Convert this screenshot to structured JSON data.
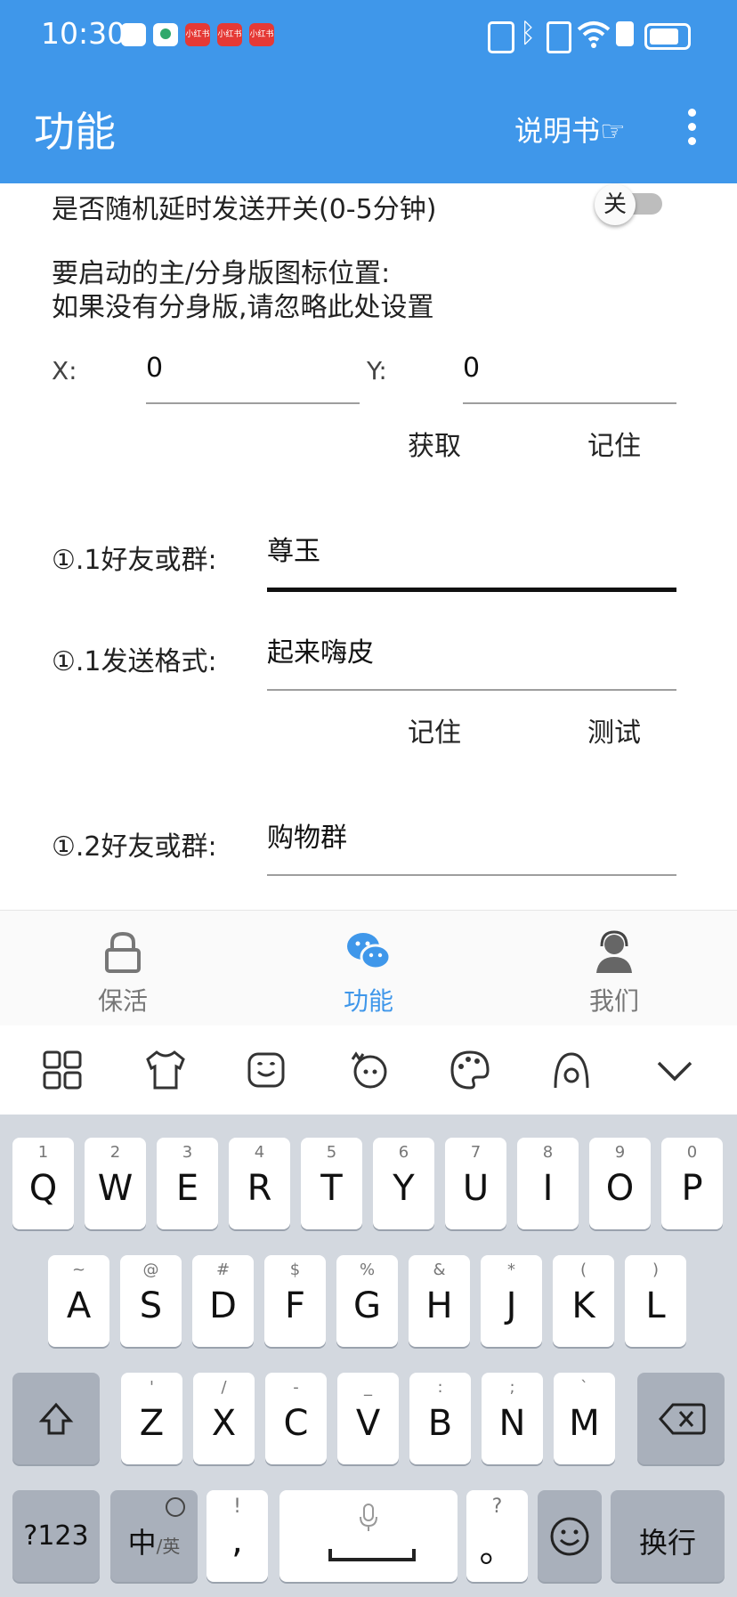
{
  "status_bar": {
    "time": "10:30",
    "app_icon_text": "小红书",
    "accent": "#3f97ea"
  },
  "app_bar": {
    "title": "功能",
    "manual_label": "说明书☞",
    "more_icon": "more-vert-icon"
  },
  "settings": {
    "random_delay_label": "是否随机延时发送开关(0-5分钟)",
    "random_delay_switch_text": "关",
    "icon_position_line1": "要启动的主/分身版图标位置:",
    "icon_position_line2": "如果没有分身版,请忽略此处设置",
    "x_label": "X:",
    "x_value": "0",
    "y_label": "Y:",
    "y_value": "0",
    "get_button": "获取",
    "remember_button": "记住"
  },
  "entries": {
    "friend1_label": "①.1好友或群:",
    "friend1_value": "尊玉",
    "format1_label": "①.1发送格式:",
    "format1_value": "起来嗨皮",
    "remember_button": "记住",
    "test_button": "测试",
    "friend2_label": "①.2好友或群:",
    "friend2_value": "购物群"
  },
  "bottom_nav": [
    {
      "label": "保活",
      "icon": "lock-icon"
    },
    {
      "label": "功能",
      "icon": "wechat-icon",
      "active": true
    },
    {
      "label": "我们",
      "icon": "support-agent-icon"
    }
  ],
  "keyboard": {
    "row1": [
      {
        "hint": "1",
        "key": "Q"
      },
      {
        "hint": "2",
        "key": "W"
      },
      {
        "hint": "3",
        "key": "E"
      },
      {
        "hint": "4",
        "key": "R"
      },
      {
        "hint": "5",
        "key": "T"
      },
      {
        "hint": "6",
        "key": "Y"
      },
      {
        "hint": "7",
        "key": "U"
      },
      {
        "hint": "8",
        "key": "I"
      },
      {
        "hint": "9",
        "key": "O"
      },
      {
        "hint": "0",
        "key": "P"
      }
    ],
    "row2": [
      {
        "hint": "~",
        "key": "A"
      },
      {
        "hint": "@",
        "key": "S"
      },
      {
        "hint": "#",
        "key": "D"
      },
      {
        "hint": "$",
        "key": "F"
      },
      {
        "hint": "%",
        "key": "G"
      },
      {
        "hint": "&",
        "key": "H"
      },
      {
        "hint": "*",
        "key": "J"
      },
      {
        "hint": "(",
        "key": "K"
      },
      {
        "hint": ")",
        "key": "L"
      }
    ],
    "row3": [
      {
        "hint": "'",
        "key": "Z"
      },
      {
        "hint": "/",
        "key": "X"
      },
      {
        "hint": "-",
        "key": "C"
      },
      {
        "hint": "_",
        "key": "V"
      },
      {
        "hint": ":",
        "key": "B"
      },
      {
        "hint": ";",
        "key": "N"
      },
      {
        "hint": "`",
        "key": "M"
      }
    ],
    "sym_key": "?123",
    "lang_key_main": "中",
    "lang_key_sub": "/英",
    "comma_hint": "!",
    "comma_key": ",",
    "period_hint": "?",
    "period_key": "。",
    "enter_key": "换行"
  }
}
